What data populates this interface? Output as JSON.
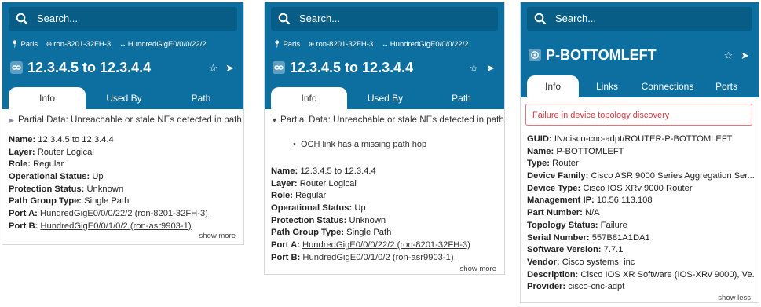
{
  "search": {
    "placeholder": "Search..."
  },
  "panel1": {
    "breadcrumb": [
      "Paris",
      "ron-8201-32FH-3",
      "HundredGigE0/0/0/22/2"
    ],
    "title": "12.3.4.5 to 12.3.4.4",
    "tabs": [
      "Info",
      "Used By",
      "Path"
    ],
    "partial_data": "Partial Data: Unreachable or stale NEs detected in path",
    "props": [
      {
        "label": "Name:",
        "value": "12.3.4.5 to 12.3.4.4"
      },
      {
        "label": "Layer:",
        "value": "Router Logical"
      },
      {
        "label": "Role:",
        "value": "Regular"
      },
      {
        "label": "Operational Status:",
        "value": "Up"
      },
      {
        "label": "Protection Status:",
        "value": "Unknown"
      },
      {
        "label": "Path Group Type:",
        "value": "Single Path"
      },
      {
        "label": "Port A:",
        "value": "HundredGigE0/0/0/22/2 (ron-8201-32FH-3)"
      },
      {
        "label": "Port B:",
        "value": "HundredGigE0/0/1/0/2 (ron-asr9903-1)"
      }
    ],
    "show_more": "show more"
  },
  "panel2": {
    "breadcrumb": [
      "Paris",
      "ron-8201-32FH-3",
      "HundredGigE0/0/0/22/2"
    ],
    "title": "12.3.4.5 to 12.3.4.4",
    "tabs": [
      "Info",
      "Used By",
      "Path"
    ],
    "partial_data": "Partial Data: Unreachable or stale NEs detected in path",
    "bullet": "OCH link has a missing path hop",
    "props": [
      {
        "label": "Name:",
        "value": "12.3.4.5 to 12.3.4.4"
      },
      {
        "label": "Layer:",
        "value": "Router Logical"
      },
      {
        "label": "Role:",
        "value": "Regular"
      },
      {
        "label": "Operational Status:",
        "value": "Up"
      },
      {
        "label": "Protection Status:",
        "value": "Unknown"
      },
      {
        "label": "Path Group Type:",
        "value": "Single Path"
      },
      {
        "label": "Port A:",
        "value": "HundredGigE0/0/0/22/2 (ron-8201-32FH-3)"
      },
      {
        "label": "Port B:",
        "value": "HundredGigE0/0/1/0/2 (ron-asr9903-1)"
      }
    ],
    "show_more": "show more"
  },
  "panel3": {
    "title": "P-BOTTOMLEFT",
    "tabs": [
      "Info",
      "Links",
      "Connections",
      "Ports"
    ],
    "error": "Failure in device topology discovery",
    "props": [
      {
        "label": "GUID:",
        "value": "IN/cisco-cnc-adpt/ROUTER-P-BOTTOMLEFT"
      },
      {
        "label": "Name:",
        "value": "P-BOTTOMLEFT"
      },
      {
        "label": "Type:",
        "value": "Router"
      },
      {
        "label": "Device Family:",
        "value": "Cisco ASR 9000 Series Aggregation Ser..."
      },
      {
        "label": "Device Type:",
        "value": "Cisco IOS XRv 9000 Router"
      },
      {
        "label": "Management IP:",
        "value": "10.56.113.108"
      },
      {
        "label": "Part Number:",
        "value": "N/A"
      },
      {
        "label": "Topology Status:",
        "value": "Failure"
      },
      {
        "label": "Serial Number:",
        "value": "557B81A1DA1"
      },
      {
        "label": "Software Version:",
        "value": "7.7.1"
      },
      {
        "label": "Vendor:",
        "value": "Cisco systems, inc"
      },
      {
        "label": "Description:",
        "value": "Cisco IOS XR Software (IOS-XRv 9000), Ve..."
      },
      {
        "label": "Provider:",
        "value": "cisco-cnc-adpt"
      }
    ],
    "show_less": "show less"
  }
}
